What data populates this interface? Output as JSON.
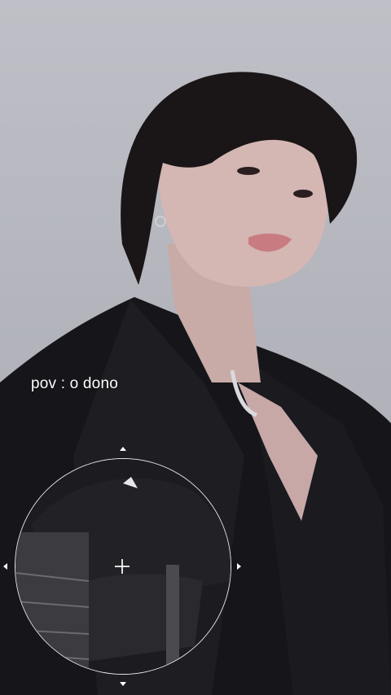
{
  "overlay": {
    "caption": "pov : o dono"
  },
  "zoom_lens": {
    "center_icon": "crosshair-icon",
    "handle_icons": [
      "arrow-up-icon",
      "arrow-down-icon",
      "arrow-left-icon",
      "arrow-right-icon"
    ]
  },
  "colors": {
    "background": "#b8b9c1",
    "caption_text": "#ffffff",
    "lens_border": "#ffffff"
  }
}
